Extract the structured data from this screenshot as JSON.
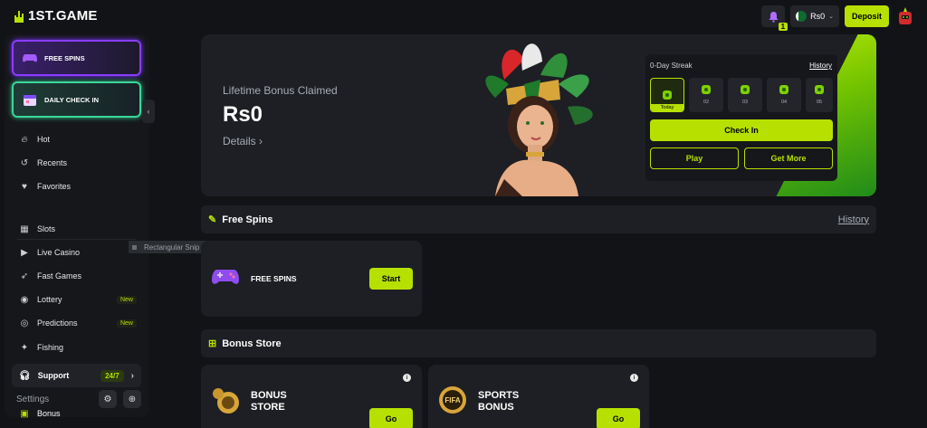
{
  "header": {
    "logo_text": "1ST.GAME",
    "notification_count": "1",
    "balance": "Rs0",
    "deposit_label": "Deposit"
  },
  "sidebar": {
    "promos": [
      {
        "label": "FREE SPINS"
      },
      {
        "label": "DAILY CHECK IN"
      }
    ],
    "items_top": [
      {
        "label": "Hot",
        "icon": "fire-icon"
      },
      {
        "label": "Recents",
        "icon": "history-icon"
      },
      {
        "label": "Favorites",
        "icon": "heart-icon"
      }
    ],
    "items_main": [
      {
        "label": "Slots",
        "icon": "slots-icon",
        "tag": ""
      },
      {
        "label": "Live Casino",
        "icon": "live-casino-icon",
        "tag": ""
      },
      {
        "label": "Fast Games",
        "icon": "rocket-icon",
        "tag": ""
      },
      {
        "label": "Lottery",
        "icon": "lottery-icon",
        "tag": "New"
      },
      {
        "label": "Predictions",
        "icon": "predictions-icon",
        "tag": "New"
      },
      {
        "label": "Fishing",
        "icon": "fish-icon",
        "tag": ""
      }
    ],
    "support_label": "Support",
    "support_badge": "24/7",
    "settings_label": "Settings",
    "bonus_label": "Bonus"
  },
  "overlay": {
    "snip_label": "Rectangular Snip"
  },
  "hero": {
    "label": "Lifetime Bonus Claimed",
    "amount": "Rs0",
    "details": "Details  ›"
  },
  "streak": {
    "title": "0-Day Streak",
    "history": "History",
    "days": [
      "Today",
      "02",
      "03",
      "04",
      "05"
    ],
    "checkin_label": "Check In",
    "play_label": "Play",
    "get_more_label": "Get More"
  },
  "free_spins": {
    "title": "Free Spins",
    "history": "History",
    "card_label": "FREE SPINS",
    "start_label": "Start"
  },
  "bonus_store": {
    "title": "Bonus Store",
    "cards": [
      {
        "line1": "BONUS",
        "line2": "STORE",
        "go": "Go"
      },
      {
        "line1": "SPORTS",
        "line2": "BONUS",
        "go": "Go"
      }
    ],
    "fifa_text": "FIFA"
  },
  "colors": {
    "accent": "#b7e000",
    "background": "#121316",
    "panel": "#1d1f24",
    "free_spins_border": "#8a3dff",
    "daily_check_border": "#3ad79a"
  }
}
